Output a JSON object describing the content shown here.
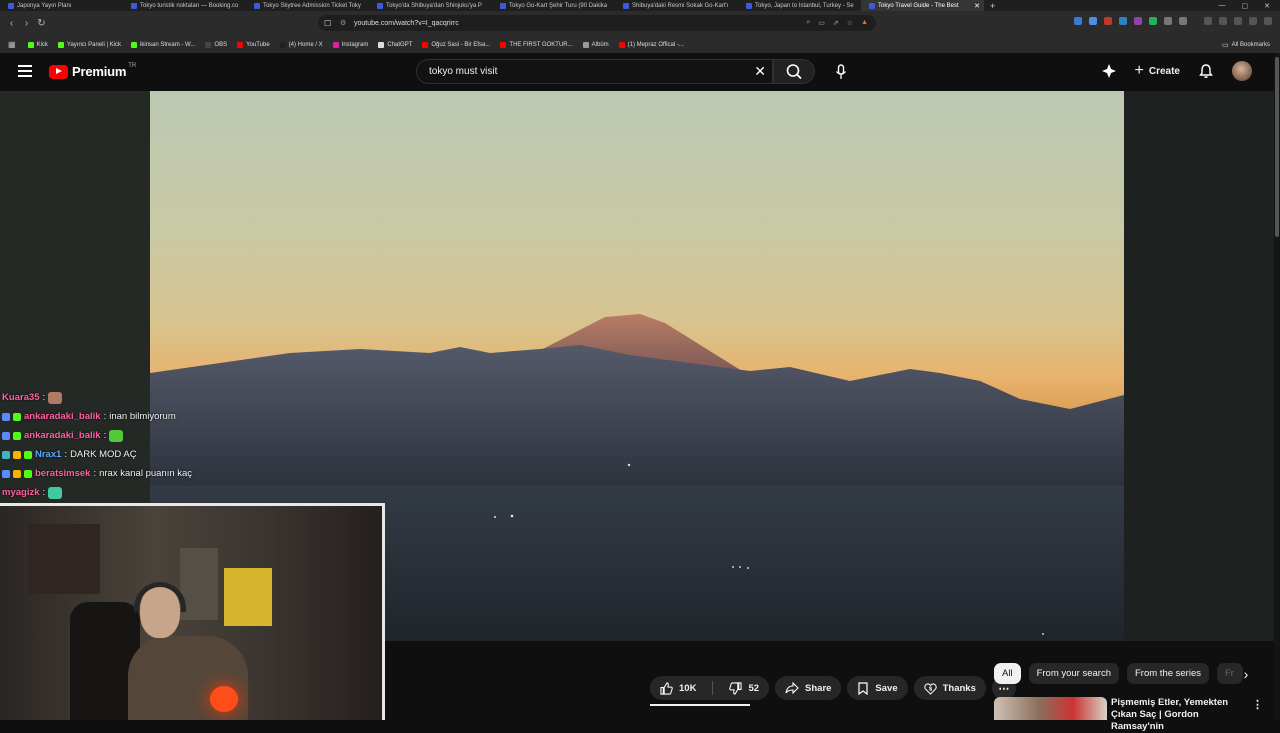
{
  "browser": {
    "tabs": [
      {
        "title": "Japonya Yayın Planı",
        "active": false
      },
      {
        "title": "Tokyo turistik noktaları — Booking.co",
        "active": false
      },
      {
        "title": "Tokyo Skytree Admission Ticket Toky",
        "active": false
      },
      {
        "title": "Tokyo'da Shibuya'dan Shinjuku'ya P",
        "active": false
      },
      {
        "title": "Tokyo Go-Kart Şehir Turu (90 Dakika",
        "active": false
      },
      {
        "title": "Shibuya'daki Resmi Sokak Go-Kart'ı",
        "active": false
      },
      {
        "title": "Tokyo, Japan to Istanbul, Turkey - Se",
        "active": false
      },
      {
        "title": "Tokyo Travel Guide - The Best",
        "active": true
      }
    ],
    "url": "youtube.com/watch?v=I_qacqrirrc",
    "bookmarks": [
      {
        "label": "Kick",
        "color": "#53fc18"
      },
      {
        "label": "Yayıncı Paneli | Kick",
        "color": "#53fc18"
      },
      {
        "label": "ikinsan Stream - W...",
        "color": "#53fc18"
      },
      {
        "label": "OBS",
        "color": "#444444"
      },
      {
        "label": "YouTube",
        "color": "#ff0000"
      },
      {
        "label": "(4) Home / X",
        "color": "#222222"
      },
      {
        "label": "Instagram",
        "color": "#d6249f"
      },
      {
        "label": "ChatGPT",
        "color": "#dddddd"
      },
      {
        "label": "Oğuz Sasi - Bir Efsa...",
        "color": "#ff0000"
      },
      {
        "label": "THE FIRST GOKTUR...",
        "color": "#ff0000"
      },
      {
        "label": "Albüm",
        "color": "#999999"
      },
      {
        "label": "(1) Mepraz Offical -...",
        "color": "#ff0000"
      }
    ],
    "all_bookmarks": "All Bookmarks"
  },
  "youtube": {
    "logo_text": "Premium",
    "region": "TR",
    "search_value": "tokyo must visit",
    "create_label": "Create"
  },
  "video": {
    "actions": {
      "likes": "10K",
      "dislikes": "52",
      "share": "Share",
      "save": "Save",
      "thanks": "Thanks"
    }
  },
  "chat": [
    {
      "user": "Kuara35",
      "user_color": "#ff5fa2",
      "message": "",
      "emote_color": "#b07a63",
      "badges": []
    },
    {
      "user": "ankaradaki_balik",
      "user_color": "#ff5fa2",
      "message": "inan bilmiyorum",
      "badges": [
        "#5b8cff",
        "#53fc18"
      ]
    },
    {
      "user": "ankaradaki_balik",
      "user_color": "#ff5fa2",
      "message": "",
      "emote_color": "#53c93a",
      "badges": [
        "#5b8cff",
        "#53fc18"
      ]
    },
    {
      "user": "Nrax1",
      "user_color": "#5aa7ff",
      "message": "DARK MOD AÇ",
      "badges": [
        "#3fb4c9",
        "#f4b400",
        "#53fc18"
      ]
    },
    {
      "user": "beratsimsek",
      "user_color": "#ff5fa2",
      "message": "nrax kanal puanın kaç",
      "badges": [
        "#5b8cff",
        "#f4b400",
        "#53fc18"
      ]
    },
    {
      "user": "myagizk",
      "user_color": "#ff5fa2",
      "message": "",
      "emote_color": "#41c9a0",
      "badges": []
    }
  ],
  "chips": [
    "All",
    "From your search",
    "From the series",
    "Fr"
  ],
  "recommendation": {
    "title": "Pişmemiş Etler, Yemekten Çıkan Saç | Gordon Ramsay'nin"
  }
}
